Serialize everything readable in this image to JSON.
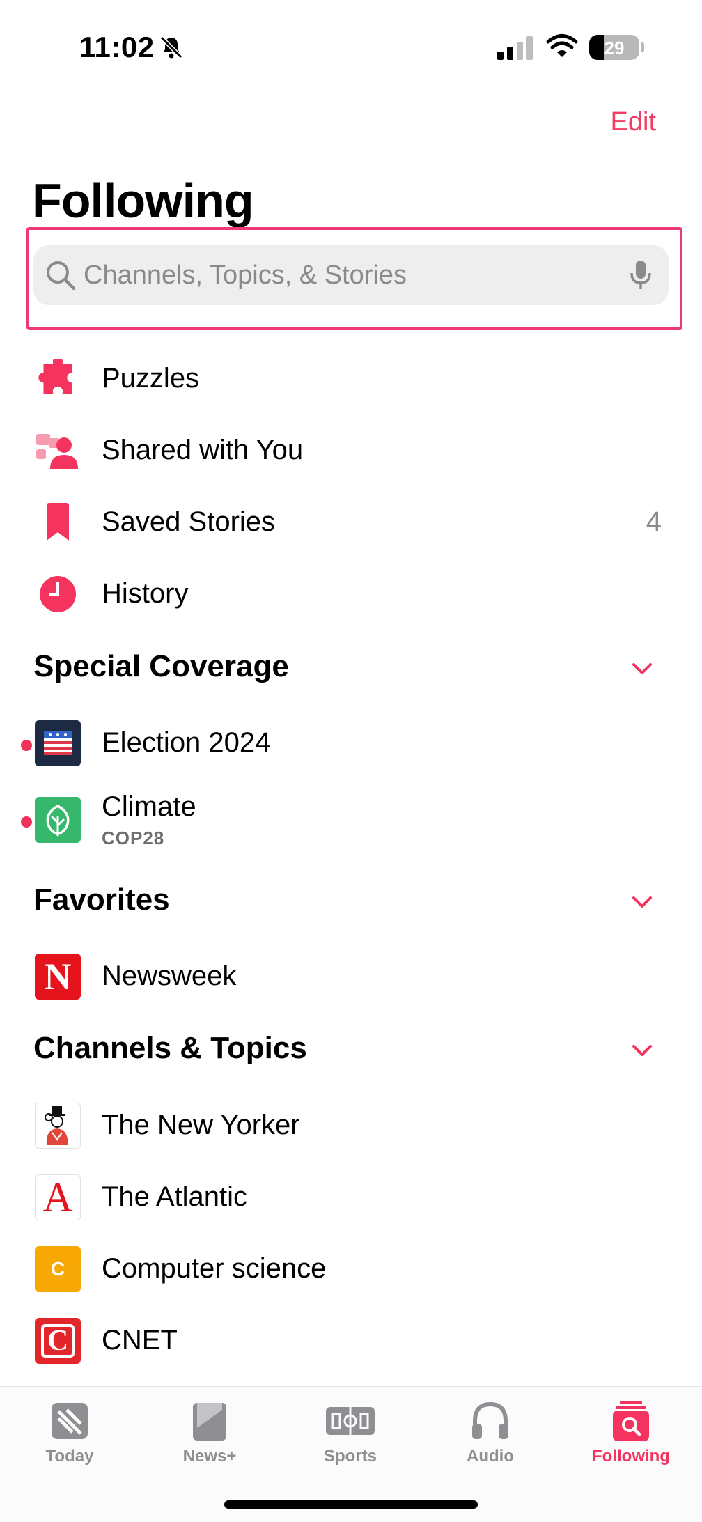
{
  "status_bar": {
    "time": "11:02",
    "battery": "29",
    "battery_level": 0.29
  },
  "header": {
    "edit_label": "Edit",
    "title": "Following"
  },
  "search": {
    "placeholder": "Channels, Topics, & Stories",
    "value": ""
  },
  "quick_links": [
    {
      "label": "Puzzles",
      "icon": "puzzle-icon"
    },
    {
      "label": "Shared with You",
      "icon": "shared-people-icon"
    },
    {
      "label": "Saved Stories",
      "icon": "bookmark-icon",
      "count": "4"
    },
    {
      "label": "History",
      "icon": "clock-icon"
    }
  ],
  "special_coverage": {
    "title": "Special Coverage",
    "items": [
      {
        "label": "Election 2024",
        "icon": "election-flag-icon"
      },
      {
        "label": "Climate",
        "sublabel": "COP28",
        "icon": "leaf-icon"
      }
    ]
  },
  "favorites": {
    "title": "Favorites",
    "items": [
      {
        "label": "Newsweek",
        "logo_letter": "N"
      }
    ]
  },
  "channels": {
    "title": "Channels & Topics",
    "items": [
      {
        "label": "The New Yorker",
        "icon": "new-yorker-logo"
      },
      {
        "label": "The Atlantic",
        "logo_letter": "A"
      },
      {
        "label": "Computer science",
        "logo_letter": "C"
      },
      {
        "label": "CNET",
        "logo_letter": "C"
      }
    ]
  },
  "tab_bar": [
    {
      "label": "Today",
      "icon": "news-icon"
    },
    {
      "label": "News+",
      "icon": "newsplus-icon"
    },
    {
      "label": "Sports",
      "icon": "sports-field-icon"
    },
    {
      "label": "Audio",
      "icon": "headphones-icon"
    },
    {
      "label": "Following",
      "icon": "following-search-icon",
      "active": true
    }
  ],
  "colors": {
    "accent": "#F5335F",
    "secondary_text": "#8A8A8E"
  }
}
